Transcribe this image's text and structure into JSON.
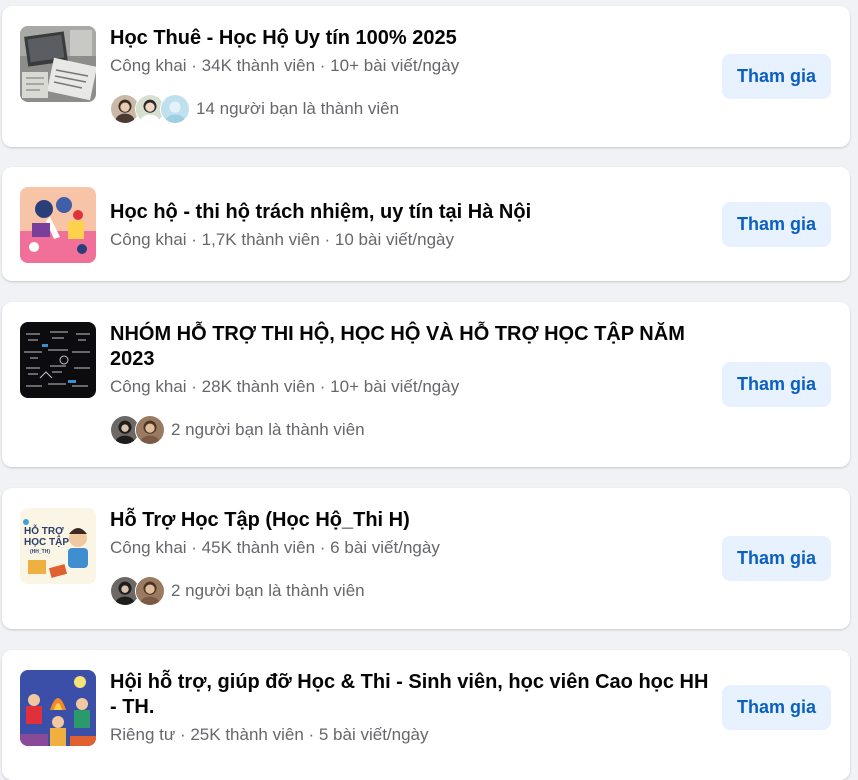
{
  "groups": [
    {
      "title": "Học Thuê - Học Hộ Uy tín 100% 2025",
      "meta": "Công khai · 34K thành viên · 10+ bài viết/ngày",
      "friends_text": "14 người bạn là thành viên",
      "join_label": "Tham gia",
      "thumbnail_icon": "laptop-desk-photo"
    },
    {
      "title": "Học hộ - thi hộ trách nhiệm, uy tín tại Hà Nội",
      "meta": "Công khai · 1,7K thành viên · 10 bài viết/ngày",
      "join_label": "Tham gia",
      "thumbnail_icon": "study-illustration"
    },
    {
      "title": "NHÓM HỖ TRỢ THI HỘ, HỌC HỘ VÀ HỖ TRỢ HỌC TẬP NĂM 2023",
      "meta": "Công khai · 28K thành viên · 10+ bài viết/ngày",
      "friends_text": "2 người bạn là thành viên",
      "join_label": "Tham gia",
      "thumbnail_icon": "dark-chalkboard"
    },
    {
      "title": "Hỗ Trợ Học Tập (Học Hộ_Thi H)",
      "meta": "Công khai · 45K thành viên · 6 bài viết/ngày",
      "friends_text": "2 người bạn là thành viên",
      "join_label": "Tham gia",
      "thumbnail_icon": "ho-tro-hoc-tap-logo",
      "thumbnail_text": [
        "HỖ TRỢ",
        "HỌC TẬP",
        "(HH_TH)"
      ]
    },
    {
      "title": "Hội hỗ trợ, giúp đỡ Học & Thi - Sinh viên, học viên Cao học HH - TH.",
      "meta": "Riêng tư · 25K thành viên · 5 bài viết/ngày",
      "join_label": "Tham gia",
      "thumbnail_icon": "students-illustration"
    }
  ],
  "colors": {
    "page_bg": "#f0f2f5",
    "card_bg": "#ffffff",
    "title": "#050505",
    "meta": "#65676b",
    "join_bg": "#e7f2fe",
    "join_text": "#0b5fc1"
  }
}
